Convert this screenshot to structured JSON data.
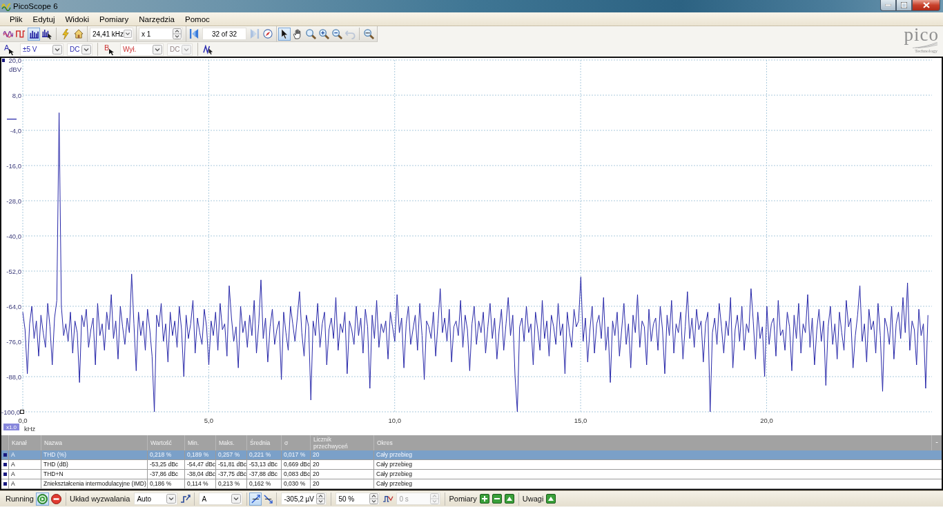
{
  "window": {
    "title": "PicoScope 6"
  },
  "menu": [
    "Plik",
    "Edytuj",
    "Widoki",
    "Pomiary",
    "Narzędzia",
    "Pomoc"
  ],
  "toolbar": {
    "view_modes": [
      {
        "selected": false
      },
      {
        "selected": false
      },
      {
        "selected": true
      },
      {
        "selected": false
      }
    ],
    "timebase": "24,41 kHz",
    "zoom_factor": "x 1",
    "buffer": {
      "position": "32 of 32",
      "previous_disabled": false,
      "next_disabled": true
    },
    "tools": [
      {
        "selected": true,
        "disabled": false
      },
      {
        "selected": false,
        "disabled": false
      },
      {
        "selected": false,
        "disabled": false
      },
      {
        "selected": false,
        "disabled": false
      },
      {
        "selected": false,
        "disabled": false
      },
      {
        "selected": false,
        "disabled": true
      }
    ]
  },
  "channels": [
    {
      "label": "A",
      "color": "#2b2bb0",
      "range": "±5 V",
      "coupling": "DC",
      "coupling_disabled": false
    },
    {
      "label": "B",
      "color": "#cc3333",
      "range": "Wył.",
      "coupling": "DC",
      "coupling_disabled": true
    }
  ],
  "logo": {
    "name": "pico",
    "tagline": "Technology"
  },
  "spectrum": {
    "x_scale": "x1.0",
    "chart_data": {
      "type": "line",
      "xlabel": "kHz",
      "ylabel": "dBV",
      "grid": true,
      "xlim": [
        0,
        24.41
      ],
      "ylim": [
        -100,
        20
      ],
      "xticks": [
        {
          "value": 0,
          "label": "0,0"
        },
        {
          "value": 5,
          "label": "5,0"
        },
        {
          "value": 10,
          "label": "10,0"
        },
        {
          "value": 15,
          "label": "15,0"
        },
        {
          "value": 20,
          "label": "20,0"
        }
      ],
      "yticks": [
        {
          "value": 20,
          "label": "20,0"
        },
        {
          "value": 8,
          "label": "8,0"
        },
        {
          "value": -4,
          "label": "-4,0"
        },
        {
          "value": -16,
          "label": "-16,0"
        },
        {
          "value": -28,
          "label": "-28,0"
        },
        {
          "value": -40,
          "label": "-40,0"
        },
        {
          "value": -52,
          "label": "-52,0"
        },
        {
          "value": -64,
          "label": "-64,0"
        },
        {
          "value": -76,
          "label": "-76,0"
        },
        {
          "value": -88,
          "label": "-88,0"
        },
        {
          "value": -100,
          "label": "-100,0"
        }
      ],
      "x": [
        0,
        0.061,
        0.122,
        0.183,
        0.244,
        0.305,
        0.366,
        0.427,
        0.488,
        0.549,
        0.61,
        0.671,
        0.732,
        0.793,
        0.854,
        0.915,
        0.976,
        1.037,
        1.098,
        1.159,
        1.22,
        1.281,
        1.342,
        1.403,
        1.464,
        1.525,
        1.586,
        1.647,
        1.708,
        1.769,
        1.83,
        1.891,
        1.952,
        2.013,
        2.074,
        2.135,
        2.196,
        2.257,
        2.318,
        2.379,
        2.44,
        2.501,
        2.562,
        2.623,
        2.684,
        2.745,
        2.806,
        2.867,
        2.928,
        2.989,
        3.05,
        3.111,
        3.172,
        3.233,
        3.294,
        3.355,
        3.416,
        3.477,
        3.538,
        3.599,
        3.66,
        3.721,
        3.782,
        3.843,
        3.904,
        3.965,
        4.026,
        4.087,
        4.148,
        4.209,
        4.27,
        4.331,
        4.392,
        4.453,
        4.514,
        4.575,
        4.636,
        4.697,
        4.758,
        4.819,
        4.88,
        4.941,
        5.002,
        5.063,
        5.124,
        5.185,
        5.246,
        5.307,
        5.368,
        5.429,
        5.49,
        5.551,
        5.612,
        5.673,
        5.734,
        5.795,
        5.856,
        5.917,
        5.978,
        6.039,
        6.1,
        6.161,
        6.222,
        6.283,
        6.344,
        6.405,
        6.466,
        6.527,
        6.588,
        6.649,
        6.71,
        6.771,
        6.832,
        6.893,
        6.954,
        7.015,
        7.076,
        7.137,
        7.198,
        7.259,
        7.32,
        7.381,
        7.442,
        7.503,
        7.564,
        7.625,
        7.686,
        7.747,
        7.808,
        7.869,
        7.93,
        7.991,
        8.052,
        8.113,
        8.174,
        8.235,
        8.296,
        8.357,
        8.418,
        8.479,
        8.54,
        8.601,
        8.662,
        8.723,
        8.784,
        8.845,
        8.906,
        8.967,
        9.028,
        9.089,
        9.15,
        9.211,
        9.272,
        9.333,
        9.394,
        9.455,
        9.516,
        9.577,
        9.638,
        9.699,
        9.76,
        9.821,
        9.882,
        9.943,
        10.004,
        10.065,
        10.126,
        10.187,
        10.248,
        10.309,
        10.37,
        10.431,
        10.492,
        10.553,
        10.614,
        10.675,
        10.736,
        10.797,
        10.858,
        10.919,
        10.98,
        11.041,
        11.102,
        11.163,
        11.224,
        11.285,
        11.346,
        11.407,
        11.468,
        11.529,
        11.59,
        11.651,
        11.712,
        11.773,
        11.834,
        11.895,
        11.956,
        12.017,
        12.078,
        12.139,
        12.2,
        12.261,
        12.322,
        12.383,
        12.444,
        12.505,
        12.566,
        12.627,
        12.688,
        12.749,
        12.81,
        12.871,
        12.932,
        12.993,
        13.054,
        13.115,
        13.176,
        13.237,
        13.298,
        13.359,
        13.42,
        13.481,
        13.542,
        13.603,
        13.664,
        13.725,
        13.786,
        13.847,
        13.908,
        13.969,
        14.03,
        14.091,
        14.152,
        14.213,
        14.274,
        14.335,
        14.396,
        14.457,
        14.518,
        14.579,
        14.64,
        14.701,
        14.762,
        14.823,
        14.884,
        14.945,
        15.006,
        15.067,
        15.128,
        15.189,
        15.25,
        15.311,
        15.372,
        15.433,
        15.494,
        15.555,
        15.616,
        15.677,
        15.738,
        15.799,
        15.86,
        15.921,
        15.982,
        16.043,
        16.104,
        16.165,
        16.226,
        16.287,
        16.348,
        16.409,
        16.47,
        16.531,
        16.592,
        16.653,
        16.714,
        16.775,
        16.836,
        16.897,
        16.958,
        17.019,
        17.08,
        17.141,
        17.202,
        17.263,
        17.324,
        17.385,
        17.446,
        17.507,
        17.568,
        17.629,
        17.69,
        17.751,
        17.812,
        17.873,
        17.934,
        17.995,
        18.056,
        18.117,
        18.178,
        18.239,
        18.3,
        18.361,
        18.422,
        18.483,
        18.544,
        18.605,
        18.666,
        18.727,
        18.788,
        18.849,
        18.91,
        18.971,
        19.032,
        19.093,
        19.154,
        19.215,
        19.276,
        19.337,
        19.398,
        19.459,
        19.52,
        19.581,
        19.642,
        19.703,
        19.764,
        19.825,
        19.886,
        19.947,
        20.008,
        20.069,
        20.13,
        20.191,
        20.252,
        20.313,
        20.374,
        20.435,
        20.496,
        20.557,
        20.618,
        20.679,
        20.74,
        20.801,
        20.862,
        20.923,
        20.984,
        21.045,
        21.106,
        21.167,
        21.228,
        21.289,
        21.35,
        21.411,
        21.472,
        21.533,
        21.594,
        21.655,
        21.716,
        21.777,
        21.838,
        21.899,
        21.96,
        22.021,
        22.082,
        22.143,
        22.204,
        22.265,
        22.326,
        22.387,
        22.448,
        22.509,
        22.57,
        22.631,
        22.692,
        22.753,
        22.814,
        22.875,
        22.936,
        22.997,
        23.058,
        23.119,
        23.18,
        23.241,
        23.302,
        23.363,
        23.424,
        23.485,
        23.546,
        23.607,
        23.668,
        23.729,
        23.79,
        23.851,
        23.912,
        23.973,
        24.034,
        24.095,
        24.156,
        24.217,
        24.278,
        24.339
      ],
      "series": [
        {
          "color": "#2626a8",
          "values": [
            -66,
            -72,
            -87,
            -70,
            -64,
            -75,
            -69,
            -81,
            -67,
            -73,
            -78,
            -63,
            -71,
            -84,
            -68,
            -62,
            2,
            -64,
            -74,
            -70,
            -76,
            -66,
            -80,
            -69,
            -73,
            -90,
            -67,
            -71,
            -65,
            -78,
            -72,
            -68,
            -84,
            -63,
            -74,
            -70,
            -79,
            -66,
            -72,
            -60,
            -75,
            -69,
            -82,
            -64,
            -71,
            -77,
            -68,
            -73,
            -53,
            -70,
            -86,
            -66,
            -74,
            -69,
            -79,
            -65,
            -72,
            -81,
            -100,
            -67,
            -71,
            -63,
            -76,
            -70,
            -83,
            -66,
            -74,
            -69,
            -78,
            -64,
            -72,
            -88,
            -67,
            -75,
            -70,
            -62,
            -80,
            -68,
            -73,
            -77,
            -65,
            -71,
            -84,
            -69,
            -74,
            -66,
            -79,
            -63,
            -72,
            -70,
            -81,
            -57,
            -68,
            -76,
            -71,
            -85,
            -64,
            -73,
            -69,
            -78,
            -67,
            -74,
            -62,
            -80,
            -70,
            -55,
            -75,
            -68,
            -83,
            -71,
            -65,
            -77,
            -72,
            -69,
            -89,
            -66,
            -73,
            -79,
            -64,
            -70,
            -76,
            -68,
            -59,
            -73,
            -81,
            -67,
            -71,
            -96,
            -69,
            -74,
            -63,
            -78,
            -70,
            -66,
            -84,
            -72,
            -68,
            -75,
            -61,
            -79,
            -70,
            -73,
            -66,
            -87,
            -69,
            -72,
            -77,
            -64,
            -74,
            -68,
            -80,
            -65,
            -71,
            -92,
            -67,
            -75,
            -62,
            -78,
            -70,
            -73,
            -69,
            -82,
            -66,
            -71,
            -76,
            -60,
            -73,
            -68,
            -85,
            -70,
            -64,
            -77,
            -72,
            -67,
            -79,
            -63,
            -74,
            -89,
            -69,
            -71,
            -75,
            -66,
            -81,
            -70,
            -58,
            -73,
            -68,
            -76,
            -65,
            -83,
            -71,
            -69,
            -74,
            -62,
            -78,
            -67,
            -72,
            -86,
            -70,
            -64,
            -77,
            -69,
            -73,
            -66,
            -80,
            -71,
            -63,
            -75,
            -68,
            -82,
            -72,
            -65,
            -79,
            -70,
            -61,
            -74,
            -67,
            -88,
            -100,
            -71,
            -68,
            -76,
            -64,
            -73,
            -70,
            -84,
            -66,
            -72,
            -79,
            -62,
            -75,
            -69,
            -81,
            -67,
            -71,
            -77,
            -63,
            -74,
            -70,
            -87,
            -66,
            -73,
            -78,
            -65,
            -71,
            -69,
            -54,
            -76,
            -68,
            -83,
            -72,
            -64,
            -80,
            -70,
            -67,
            -75,
            -61,
            -79,
            -71,
            -90,
            -69,
            -74,
            -66,
            -81,
            -72,
            -63,
            -77,
            -70,
            -85,
            -67,
            -73,
            -60,
            -78,
            -69,
            -71,
            -84,
            -65,
            -76,
            -70,
            -68,
            -79,
            -64,
            -72,
            -87,
            -67,
            -74,
            -62,
            -80,
            -70,
            -73,
            -66,
            -82,
            -71,
            -59,
            -75,
            -68,
            -78,
            -65,
            -72,
            -69,
            -83,
            -70,
            -66,
            -100,
            -73,
            -68,
            -77,
            -63,
            -71,
            -80,
            -69,
            -74,
            -61,
            -85,
            -72,
            -67,
            -76,
            -64,
            -79,
            -70,
            -73,
            -58,
            -69,
            -82,
            -66,
            -75,
            -71,
            -88,
            -64,
            -77,
            -70,
            -68,
            -81,
            -62,
            -74,
            -72,
            -79,
            -66,
            -71,
            -86,
            -67,
            -75,
            -63,
            -80,
            -70,
            -73,
            -60,
            -78,
            -68,
            -84,
            -72,
            -65,
            -76,
            -69,
            -91,
            -71,
            -64,
            -77,
            -70,
            -82,
            -66,
            -73,
            -79,
            -62,
            -71,
            -68,
            -85,
            -74,
            -67,
            -57,
            -76,
            -70,
            -83,
            -65,
            -72,
            -69,
            -80,
            -63,
            -74,
            -93,
            -68,
            -71,
            -77,
            -64,
            -82,
            -70,
            -66,
            -75,
            -61,
            -73,
            -56,
            -79,
            -69,
            -72,
            -84,
            -65,
            -74,
            -70,
            -92,
            -67
          ]
        }
      ]
    }
  },
  "measurements": {
    "columns": [
      "Kanał",
      "Nazwa",
      "Wartość",
      "Min.",
      "Maks.",
      "Średnia",
      "σ",
      "Licznik przechwyceń",
      "Okres"
    ],
    "collapse": "-",
    "rows": [
      {
        "selected": true,
        "cells": [
          "A",
          "THD (%)",
          "0,218 %",
          "0,189 %",
          "0,257 %",
          "0,221 %",
          "0,017 %",
          "20",
          "Cały przebieg"
        ]
      },
      {
        "selected": false,
        "cells": [
          "A",
          "THD (dB)",
          "-53,25 dBc",
          "-54,47 dBc",
          "-51,81 dBc",
          "-53,13 dBc",
          "0,669 dBc",
          "20",
          "Cały przebieg"
        ]
      },
      {
        "selected": false,
        "cells": [
          "A",
          "THD+N",
          "-37,86 dBc",
          "-38,04 dBc",
          "-37,75 dBc",
          "-37,88 dBc",
          "0,083 dBc",
          "20",
          "Cały przebieg"
        ]
      },
      {
        "selected": false,
        "cells": [
          "A",
          "Zniekształcenia intermodulacyjne (IMD)",
          "0,186 %",
          "0,114 %",
          "0,213 %",
          "0,162 %",
          "0,030 %",
          "20",
          "Cały przebieg"
        ]
      }
    ]
  },
  "status_bar": {
    "state": "Running",
    "run_controls": [
      {
        "selected": true
      },
      {
        "selected": false
      }
    ],
    "trigger_label": "Układ wyzwalania",
    "trigger_mode": "Auto",
    "trigger_source": "A",
    "edges": [
      {
        "selected": true
      },
      {
        "selected": false
      }
    ],
    "threshold": "-305,2 µV",
    "pre_trigger": "50 %",
    "delay": {
      "value": "0 s",
      "disabled": true
    },
    "measurements_label": "Pomiary",
    "notes_label": "Uwagi"
  }
}
